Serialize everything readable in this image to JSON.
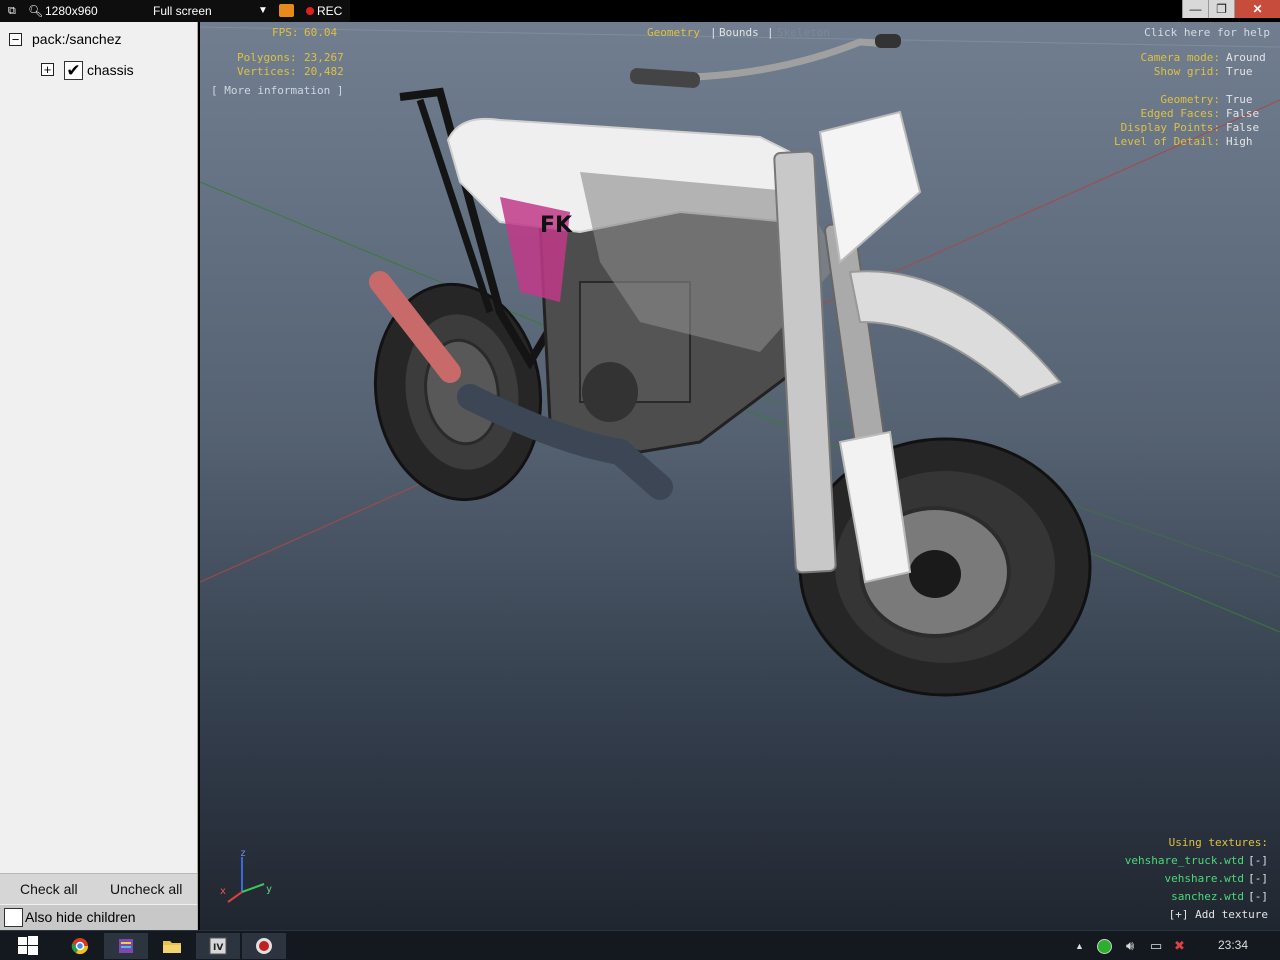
{
  "recorder": {
    "resolution": "1280x960",
    "mode": "Full screen",
    "rec_label": "REC"
  },
  "window": {
    "minimize": "—",
    "restore": "❐",
    "close": "✕"
  },
  "tree": {
    "root": {
      "toggle": "−",
      "label": "pack:/sanchez"
    },
    "child": {
      "toggle": "+",
      "checked_glyph": "✔",
      "label": "chassis"
    }
  },
  "sidebar": {
    "check_all": "Check all",
    "uncheck_all": "Uncheck all",
    "also_hide_children": "Also hide children"
  },
  "hud": {
    "fps_label": "FPS:",
    "fps_value": "60.04",
    "polygons_label": "Polygons:",
    "polygons_value": "23,267",
    "vertices_label": "Vertices:",
    "vertices_value": "20,482",
    "more_info": "[ More information ]",
    "tabs": {
      "geometry": "Geometry",
      "sep1": "|",
      "bounds": "Bounds",
      "sep2": "|",
      "skeleton": "Skeleton"
    },
    "help": "Click here for help",
    "camera_mode_label": "Camera mode:",
    "camera_mode_value": "Around",
    "show_grid_label": "Show grid:",
    "show_grid_value": "True",
    "geometry_label": "Geometry:",
    "geometry_value": "True",
    "edged_faces_label": "Edged Faces:",
    "edged_faces_value": "False",
    "display_points_label": "Display Points:",
    "display_points_value": "False",
    "lod_label": "Level of Detail:",
    "lod_value": "High",
    "using_textures": "Using textures:",
    "textures": [
      {
        "name": "vehshare_truck.wtd",
        "remove": "[-]"
      },
      {
        "name": "vehshare.wtd",
        "remove": "[-]"
      },
      {
        "name": "sanchez.wtd",
        "remove": "[-]"
      }
    ],
    "add_texture": "[+] Add texture",
    "axis": {
      "z": "z",
      "x": "x",
      "y": "y"
    }
  },
  "bike_decal": "FK",
  "taskbar": {
    "clock": "23:34"
  },
  "colors": {
    "hud_yellow": "#e0c040",
    "hud_green": "#4cd87a",
    "rec_red": "#e02020",
    "close_red": "#c74c3c"
  }
}
